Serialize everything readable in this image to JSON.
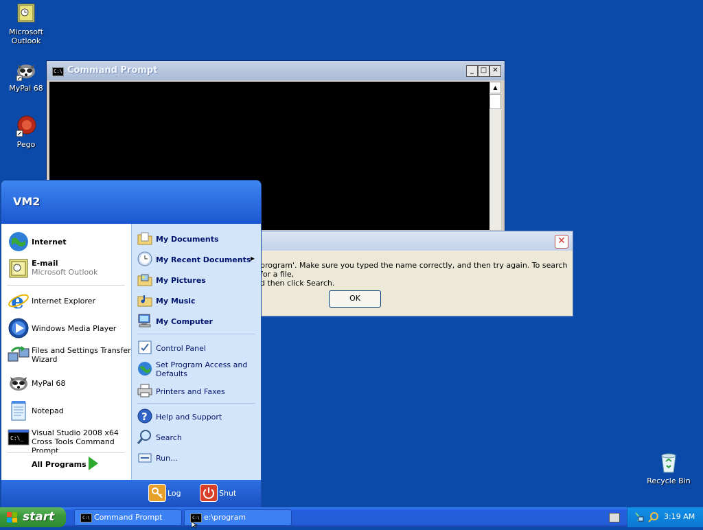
{
  "desktop": {
    "icons": [
      {
        "label": "Microsoft Outlook",
        "icon": "outlook-icon"
      },
      {
        "label": "MyPal 68",
        "icon": "mypal-raccoon-icon"
      },
      {
        "label": "Pego",
        "icon": "pego-icon"
      },
      {
        "label": "Recycle Bin",
        "icon": "recycle-bin-icon"
      }
    ]
  },
  "cmd_window": {
    "title": "Command Prompt",
    "icon_text": "C:\\",
    "minimize": "_",
    "maximize": "□",
    "close": "✕"
  },
  "error_dialog": {
    "message": "program'. Make sure you typed the name correctly, and then try again. To search for a file,\nd then click Search.",
    "ok_label": "OK",
    "close": "✕"
  },
  "start_menu": {
    "user": "VM2",
    "left_items": [
      {
        "label": "Internet",
        "bold": true,
        "icon": "internet-globe-icon"
      },
      {
        "label": "E-mail",
        "sub": "Microsoft Outlook",
        "bold": true,
        "icon": "email-outlook-icon"
      },
      {
        "label": "Internet Explorer",
        "icon": "internet-explorer-icon"
      },
      {
        "label": "Windows Media Player",
        "icon": "windows-media-player-icon"
      },
      {
        "label": "Files and Settings Transfer Wizard",
        "icon": "transfer-wizard-icon"
      },
      {
        "label": "MyPal 68",
        "icon": "mypal-raccoon-icon"
      },
      {
        "label": "Notepad",
        "icon": "notepad-icon"
      },
      {
        "label": "Visual Studio 2008 x64 Cross Tools Command Prompt",
        "icon": "command-prompt-icon"
      }
    ],
    "all_programs": "All Programs",
    "right_items": [
      {
        "label": "My Documents",
        "icon": "folder-documents-icon"
      },
      {
        "label": "My Recent Documents",
        "icon": "recent-documents-icon",
        "arrow": "▸"
      },
      {
        "label": "My Pictures",
        "icon": "folder-pictures-icon"
      },
      {
        "label": "My Music",
        "icon": "folder-music-icon"
      },
      {
        "label": "My Computer",
        "icon": "computer-icon"
      },
      {
        "label": "Control Panel",
        "icon": "control-panel-icon"
      },
      {
        "label": "Set Program Access and Defaults",
        "icon": "program-access-icon"
      },
      {
        "label": "Printers and Faxes",
        "icon": "printer-icon"
      },
      {
        "label": "Help and Support",
        "icon": "help-icon"
      },
      {
        "label": "Search",
        "icon": "search-icon"
      },
      {
        "label": "Run...",
        "icon": "run-icon"
      }
    ],
    "log_off": "Log Off",
    "shut_down": "Shut Down"
  },
  "taskbar": {
    "start_label": "start",
    "buttons": [
      {
        "label": "Command Prompt",
        "icon_text": "C:\\"
      },
      {
        "label": "e:\\program",
        "icon_text": "C:\\"
      }
    ],
    "clock": "3:19 AM"
  }
}
